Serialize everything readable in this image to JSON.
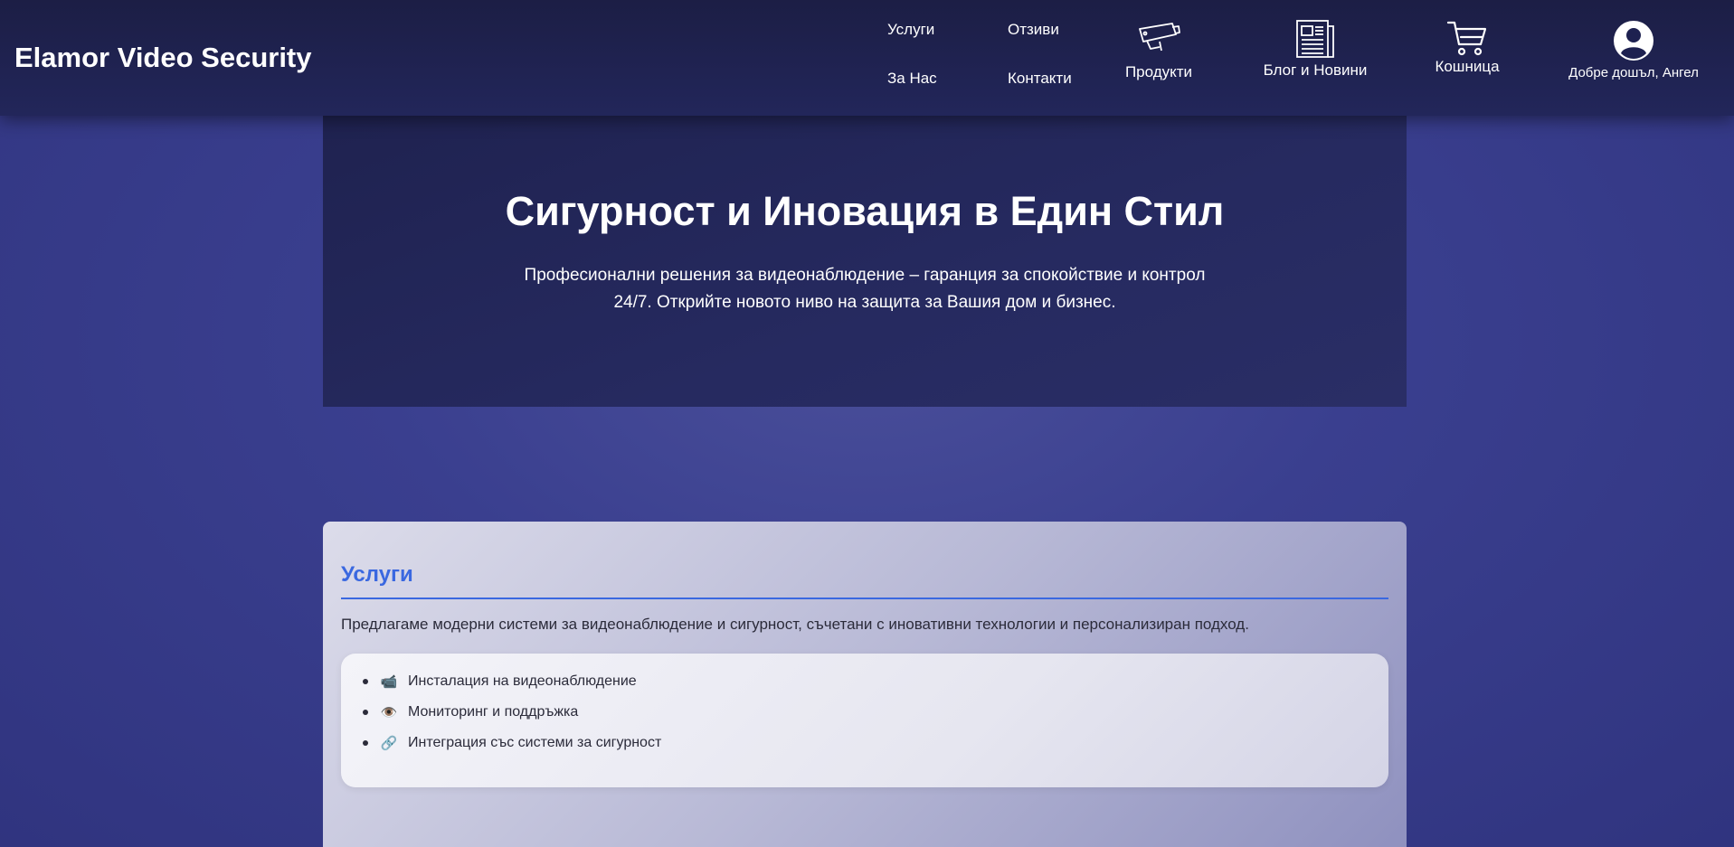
{
  "header": {
    "logo": "Elamor Video Security",
    "links": {
      "services": "Услуги",
      "reviews": "Отзиви",
      "about": "За Нас",
      "contacts": "Контакти"
    },
    "products": {
      "label": "Продукти",
      "icon": "security-camera-icon"
    },
    "blog": {
      "label": "Блог и Новини",
      "icon": "newspaper-icon"
    },
    "cart": {
      "label": "Кошница",
      "icon": "cart-icon"
    },
    "user": {
      "label": "Добре дошъл, Ангел",
      "icon": "user-avatar-icon"
    }
  },
  "hero": {
    "title": "Сигурност и Иновация в Един Стил",
    "text": "Професионални решения за видеонаблюдение – гаранция за спокойствие и контрол 24/7. Открийте новото ниво на защита за Вашия дом и бизнес."
  },
  "services": {
    "title": "Услуги",
    "text": "Предлагаме модерни системи за видеонаблюдение и сигурност, съчетани с иновативни технологии и персонализиран подход.",
    "items": [
      {
        "emoji": "📹",
        "label": "Инсталация на видеонаблюдение"
      },
      {
        "emoji": "👁️",
        "label": "Мониторинг и поддръжка"
      },
      {
        "emoji": "🔗",
        "label": "Интеграция със системи за сигурност"
      }
    ]
  },
  "colors": {
    "accent": "#3a68e0",
    "header_bg": "#1c1e45",
    "page_bg": "#3a3f8f"
  }
}
